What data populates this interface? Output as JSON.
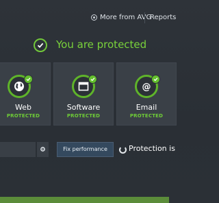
{
  "header": {
    "more_from_avg": "More from AVG",
    "reports": "Reports"
  },
  "status": {
    "message": "You are protected",
    "icon": "check-circle-icon",
    "color": "#79d23b"
  },
  "tiles": [
    {
      "name": "Web",
      "state": "PROTECTED",
      "icon": "globe-icon"
    },
    {
      "name": "Software",
      "state": "PROTECTED",
      "icon": "window-icon"
    },
    {
      "name": "Email",
      "state": "PROTECTED",
      "icon": "at-sign-icon"
    }
  ],
  "bottom": {
    "fix_performance": "Fix performance",
    "protection_text": "Protection is"
  }
}
